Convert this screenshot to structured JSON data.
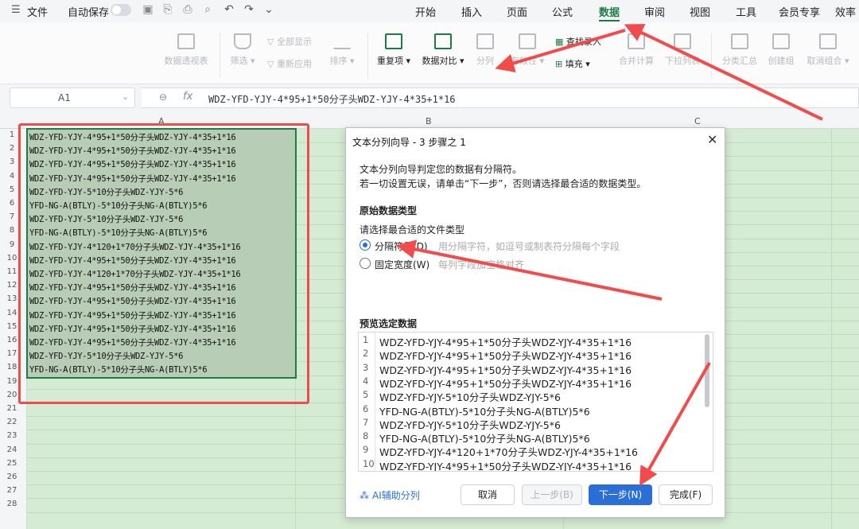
{
  "topbar": {
    "file": "文件",
    "autosave": "自动保存",
    "tabs": [
      "开始",
      "插入",
      "页面",
      "公式",
      "数据",
      "审阅",
      "视图",
      "工具",
      "会员专享",
      "效率"
    ],
    "active_tab": "数据"
  },
  "ribbon": {
    "pivot": "数据透视表",
    "filter": "筛选",
    "show_all": "全部显示",
    "reapply": "重新应用",
    "sort": "排序",
    "duplicates": "重复项",
    "compare": "数据对比",
    "split": "分列",
    "validity": "有效性",
    "lookup": "查找录入",
    "fill": "填充",
    "consolidate": "合并计算",
    "dropdown": "下拉列表",
    "subtotal": "分类汇总",
    "group": "创建组",
    "ungroup": "取消组合"
  },
  "formula_bar": {
    "cell_ref": "A1",
    "fx": "fx",
    "content": "WDZ-YFD-YJY-4*95+1*50分子头WDZ-YJY-4*35+1*16"
  },
  "grid": {
    "columns": [
      "A",
      "B",
      "C"
    ],
    "rows": [
      "1",
      "2",
      "3",
      "4",
      "5",
      "6",
      "7",
      "8",
      "9",
      "10",
      "11",
      "12",
      "13",
      "14",
      "15",
      "16",
      "17",
      "18",
      "19",
      "20",
      "21",
      "22",
      "23",
      "24",
      "25",
      "26",
      "27",
      "28"
    ],
    "colA": [
      "WDZ-YFD-YJY-4*95+1*50分子头WDZ-YJY-4*35+1*16",
      "WDZ-YFD-YJY-4*95+1*50分子头WDZ-YJY-4*35+1*16",
      "WDZ-YFD-YJY-4*95+1*50分子头WDZ-YJY-4*35+1*16",
      "WDZ-YFD-YJY-4*95+1*50分子头WDZ-YJY-4*35+1*16",
      "WDZ-YFD-YJY-5*10分子头WDZ-YJY-5*6",
      "YFD-NG-A(BTLY)-5*10分子头NG-A(BTLY)5*6",
      "WDZ-YFD-YJY-5*10分子头WDZ-YJY-5*6",
      "YFD-NG-A(BTLY)-5*10分子头NG-A(BTLY)5*6",
      "WDZ-YFD-YJY-4*120+1*70分子头WDZ-YJY-4*35+1*16",
      "WDZ-YFD-YJY-4*95+1*50分子头WDZ-YJY-4*35+1*16",
      "WDZ-YFD-YJY-4*120+1*70分子头WDZ-YJY-4*35+1*16",
      "WDZ-YFD-YJY-4*95+1*50分子头WDZ-YJY-4*35+1*16",
      "WDZ-YFD-YJY-4*95+1*50分子头WDZ-YJY-4*35+1*16",
      "WDZ-YFD-YJY-4*95+1*50分子头WDZ-YJY-4*35+1*16",
      "WDZ-YFD-YJY-4*95+1*50分子头WDZ-YJY-4*35+1*16",
      "WDZ-YFD-YJY-4*95+1*50分子头WDZ-YJY-4*35+1*16",
      "WDZ-YFD-YJY-5*10分子头WDZ-YJY-5*6",
      "YFD-NG-A(BTLY)-5*10分子头NG-A(BTLY)5*6"
    ]
  },
  "dialog": {
    "title": "文本分列向导 - 3 步骤之 1",
    "intro1": "文本分列向导判定您的数据有分隔符。",
    "intro2": "若一切设置无误，请单击“下一步”，否则请选择最合适的数据类型。",
    "section_type": "原始数据类型",
    "choose_label": "请选择最合适的文件类型",
    "opt_delimited": "分隔符号(D)",
    "opt_delimited_desc": "用分隔字符，如逗号或制表符分隔每个字段",
    "opt_fixed": "固定宽度(W)",
    "opt_fixed_desc": "每列字段加空格对齐",
    "section_preview": "预览选定数据",
    "preview_rows": [
      {
        "n": "1",
        "t": "WDZ-YFD-YJY-4*95+1*50分子头WDZ-YJY-4*35+1*16"
      },
      {
        "n": "2",
        "t": "WDZ-YFD-YJY-4*95+1*50分子头WDZ-YJY-4*35+1*16"
      },
      {
        "n": "3",
        "t": "WDZ-YFD-YJY-4*95+1*50分子头WDZ-YJY-4*35+1*16"
      },
      {
        "n": "4",
        "t": "WDZ-YFD-YJY-4*95+1*50分子头WDZ-YJY-4*35+1*16"
      },
      {
        "n": "5",
        "t": "WDZ-YFD-YJY-5*10分子头WDZ-YJY-5*6"
      },
      {
        "n": "6",
        "t": "YFD-NG-A(BTLY)-5*10分子头NG-A(BTLY)5*6"
      },
      {
        "n": "7",
        "t": "WDZ-YFD-YJY-5*10分子头WDZ-YJY-5*6"
      },
      {
        "n": "8",
        "t": "YFD-NG-A(BTLY)-5*10分子头NG-A(BTLY)5*6"
      },
      {
        "n": "9",
        "t": "WDZ-YFD-YJY-4*120+1*70分子头WDZ-YJY-4*35+1*16"
      },
      {
        "n": "10",
        "t": "WDZ-YFD-YJY-4*95+1*50分子头WDZ-YJY-4*35+1*16"
      }
    ],
    "ai_split": "AI辅助分列",
    "btn_cancel": "取消",
    "btn_prev": "上一步(B)",
    "btn_next": "下一步(N)",
    "btn_finish": "完成(F)"
  },
  "colors": {
    "accent_green": "#1e7b45",
    "annotation_red": "#f24b4b",
    "primary_blue": "#2b6fd6",
    "cell_green": "#d6ebd3"
  }
}
